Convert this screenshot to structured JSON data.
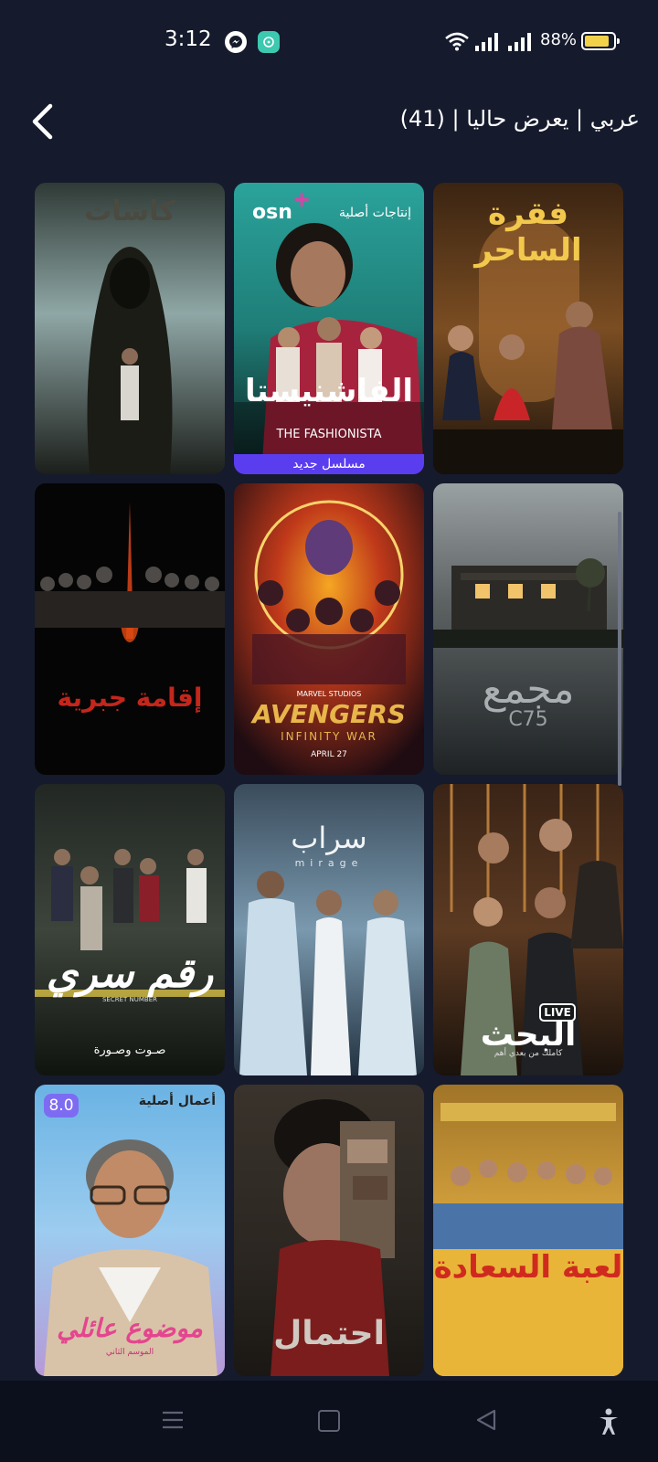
{
  "status_bar": {
    "time": "3:12",
    "battery": "88%",
    "battery_level": 0.88,
    "icons": [
      "messenger-icon",
      "chat-icon",
      "wifi-icon",
      "signal-icon",
      "signal-icon",
      "battery-icon"
    ]
  },
  "header": {
    "title": "عربي | يعرض حاليا | (41)",
    "back_icon": "chevron-left-icon"
  },
  "posters": [
    {
      "title": "كاشات"
    },
    {
      "title": "الفاشنيستا",
      "subtitle": "THE FASHIONISTA",
      "banner": "مسلسل جديد",
      "brand": "osn",
      "brand_plus": "+",
      "brand_label": "إنتاجات أصلية"
    },
    {
      "title": "فقرة الساحر"
    },
    {
      "title": "إقامة جبرية"
    },
    {
      "title": "AVENGERS",
      "subtitle": "INFINITY WAR",
      "top_label": "MARVEL STUDIOS",
      "bottom_label": "APRIL 27"
    },
    {
      "title": "مجمع",
      "subtitle": "C75"
    },
    {
      "title": "رقم سري",
      "subtitle": "صـوت وصـورة",
      "top_label": "SECRET NUMBER"
    },
    {
      "title": "سراب",
      "subtitle": "mirage"
    },
    {
      "title": "البحث",
      "live": "LIVE",
      "subtitle": "كاملك من بعدي أهم"
    },
    {
      "title": "موضوع عائلي",
      "subtitle": "الموسم الثاني",
      "badge": "أعمال أصلية",
      "rating": "8.0"
    },
    {
      "title": "احتمال"
    },
    {
      "title": "لعبة السعادة"
    }
  ],
  "nav": {
    "icons": [
      "menu-icon",
      "home-icon",
      "back-icon",
      "accessibility-icon"
    ]
  },
  "colors": {
    "background": "#151a2c",
    "accent": "#5b3df0",
    "rating": "#7d6cf2",
    "nav_bg": "#0c0f1c"
  }
}
